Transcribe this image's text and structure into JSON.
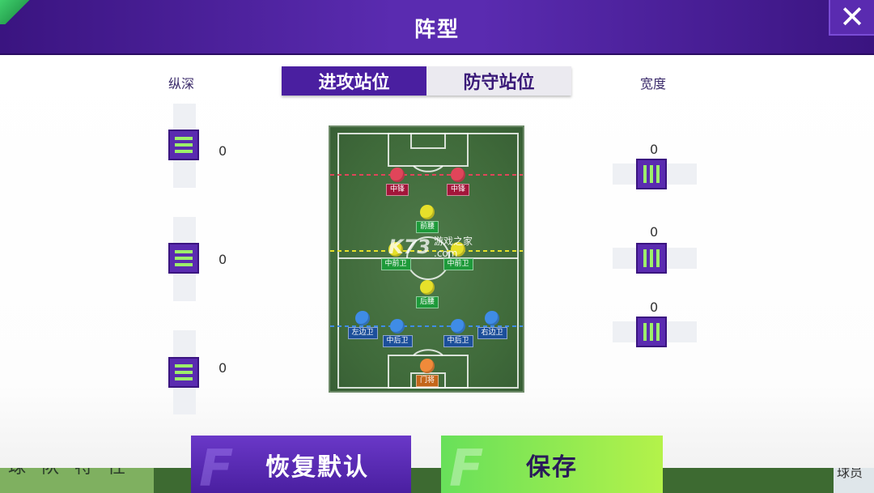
{
  "header": {
    "title": "阵型"
  },
  "tabs": {
    "attack": "进攻站位",
    "defense": "防守站位"
  },
  "depth": {
    "label": "纵深",
    "values": [
      "0",
      "0",
      "0"
    ]
  },
  "width": {
    "label": "宽度",
    "values": [
      "0",
      "0",
      "0"
    ]
  },
  "players": [
    {
      "role": "中锋",
      "color": "#e0455a",
      "tag_color": "#a3163a"
    },
    {
      "role": "中锋",
      "color": "#e0455a",
      "tag_color": "#a3163a"
    },
    {
      "role": "前腰",
      "color": "#e6e02a",
      "tag_color": "#1e9a3a"
    },
    {
      "role": "中前卫",
      "color": "#e6e02a",
      "tag_color": "#1e9a3a"
    },
    {
      "role": "中前卫",
      "color": "#e6e02a",
      "tag_color": "#1e9a3a"
    },
    {
      "role": "后腰",
      "color": "#e6e02a",
      "tag_color": "#1e9a3a"
    },
    {
      "role": "左边卫",
      "color": "#3f8ce6",
      "tag_color": "#1c4f9a"
    },
    {
      "role": "中后卫",
      "color": "#3f8ce6",
      "tag_color": "#1c4f9a"
    },
    {
      "role": "中后卫",
      "color": "#3f8ce6",
      "tag_color": "#1c4f9a"
    },
    {
      "role": "右边卫",
      "color": "#3f8ce6",
      "tag_color": "#1c4f9a"
    },
    {
      "role": "门将",
      "color": "#f08a3a",
      "tag_color": "#c4661a"
    }
  ],
  "lines": {
    "attack": "#e0455a",
    "mid": "#e6e02a",
    "defense": "#3f8ce6"
  },
  "buttons": {
    "reset": "恢复默认",
    "save": "保存",
    "icon_glyph": "F"
  },
  "background": {
    "left_text": "球 队 特 性",
    "right_text": "球员"
  },
  "watermark": {
    "logo": "K73",
    "text": "游戏之家",
    "sub": ".com"
  }
}
